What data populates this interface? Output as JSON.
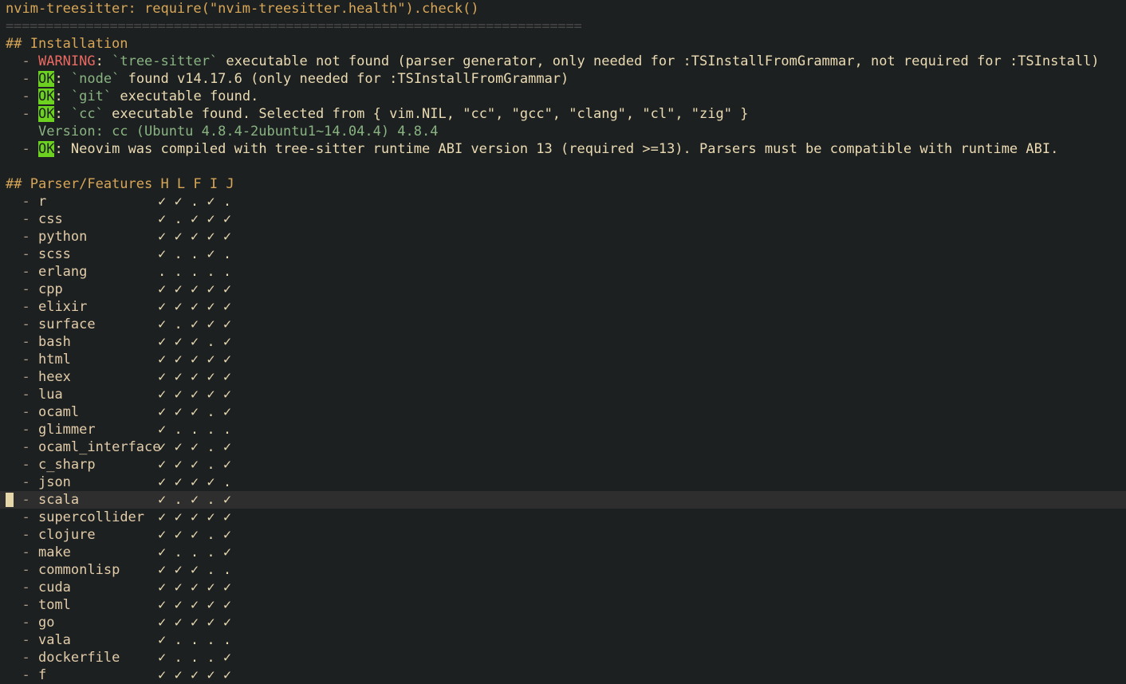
{
  "header": {
    "title": "nvim-treesitter: require(\"nvim-treesitter.health\").check()",
    "rule": "========================================================================"
  },
  "installation": {
    "heading": "## Installation",
    "items": [
      {
        "status": "WARNING",
        "kind": "warn",
        "pre": ": ",
        "code": "`tree-sitter`",
        "post": " executable not found (parser generator, only needed for :TSInstallFromGrammar, not required for :TSInstall)"
      },
      {
        "status": "OK",
        "kind": "ok",
        "pre": ": ",
        "code": "`node`",
        "post": " found v14.17.6 (only needed for :TSInstallFromGrammar)"
      },
      {
        "status": "OK",
        "kind": "ok",
        "pre": ": ",
        "code": "`git`",
        "post": " executable found."
      },
      {
        "status": "OK",
        "kind": "ok",
        "pre": ": ",
        "code": "`cc`",
        "post": " executable found. Selected from { vim.NIL, \"cc\", \"gcc\", \"clang\", \"cl\", \"zig\" }"
      }
    ],
    "version_line": "Version: cc (Ubuntu 4.8.4-2ubuntu1~14.04.4) 4.8.4",
    "abi": {
      "status": "OK",
      "text": ": Neovim was compiled with tree-sitter runtime ABI version 13 (required >=13). Parsers must be compatible with runtime ABI."
    }
  },
  "parsers": {
    "heading": "## Parser/Features H L F I J",
    "dash": "- ",
    "rows": [
      {
        "name": "r",
        "features": "✓ ✓ . ✓ ."
      },
      {
        "name": "css",
        "features": "✓ . ✓ ✓ ✓"
      },
      {
        "name": "python",
        "features": "✓ ✓ ✓ ✓ ✓"
      },
      {
        "name": "scss",
        "features": "✓ . . ✓ ."
      },
      {
        "name": "erlang",
        "features": ". . . . ."
      },
      {
        "name": "cpp",
        "features": "✓ ✓ ✓ ✓ ✓"
      },
      {
        "name": "elixir",
        "features": "✓ ✓ ✓ ✓ ✓"
      },
      {
        "name": "surface",
        "features": "✓ . ✓ ✓ ✓"
      },
      {
        "name": "bash",
        "features": "✓ ✓ ✓ . ✓"
      },
      {
        "name": "html",
        "features": "✓ ✓ ✓ ✓ ✓"
      },
      {
        "name": "heex",
        "features": "✓ ✓ ✓ ✓ ✓"
      },
      {
        "name": "lua",
        "features": "✓ ✓ ✓ ✓ ✓"
      },
      {
        "name": "ocaml",
        "features": "✓ ✓ ✓ . ✓"
      },
      {
        "name": "glimmer",
        "features": "✓ . . . ."
      },
      {
        "name": "ocaml_interface",
        "features": "✓ ✓ ✓ . ✓"
      },
      {
        "name": "c_sharp",
        "features": "✓ ✓ ✓ . ✓"
      },
      {
        "name": "json",
        "features": "✓ ✓ ✓ ✓ ."
      },
      {
        "name": "scala",
        "features": "✓ . ✓ . ✓",
        "current": true
      },
      {
        "name": "supercollider",
        "features": "✓ ✓ ✓ ✓ ✓"
      },
      {
        "name": "clojure",
        "features": "✓ ✓ ✓ . ✓"
      },
      {
        "name": "make",
        "features": "✓ . . . ✓"
      },
      {
        "name": "commonlisp",
        "features": "✓ ✓ ✓ . ."
      },
      {
        "name": "cuda",
        "features": "✓ ✓ ✓ ✓ ✓"
      },
      {
        "name": "toml",
        "features": "✓ ✓ ✓ ✓ ✓"
      },
      {
        "name": "go",
        "features": "✓ ✓ ✓ ✓ ✓"
      },
      {
        "name": "vala",
        "features": "✓ . . . ."
      },
      {
        "name": "dockerfile",
        "features": "✓ . . . ✓"
      },
      {
        "name": "f",
        "features": "✓ ✓ ✓ ✓ ✓"
      }
    ]
  }
}
